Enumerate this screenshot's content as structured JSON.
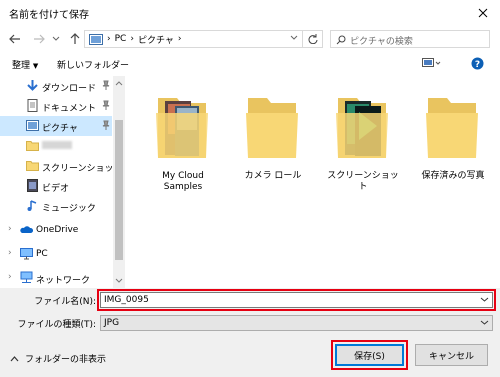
{
  "dialog": {
    "title": "名前を付けて保存"
  },
  "nav": {
    "breadcrumb": [
      "PC",
      "ピクチャ"
    ],
    "search_placeholder": "ピクチャの検索"
  },
  "toolbar": {
    "organize": "整理",
    "new_folder": "新しいフォルダー"
  },
  "sidebar": {
    "items": [
      {
        "label": "ダウンロード"
      },
      {
        "label": "ドキュメント"
      },
      {
        "label": "ピクチャ"
      },
      {
        "label": ""
      },
      {
        "label": "スクリーンショット"
      },
      {
        "label": "ビデオ"
      },
      {
        "label": "ミュージック"
      },
      {
        "label": "OneDrive"
      },
      {
        "label": "PC"
      },
      {
        "label": "ネットワーク"
      }
    ]
  },
  "folders": [
    {
      "label": "My Cloud Samples"
    },
    {
      "label": "カメラ ロール"
    },
    {
      "label": "スクリーンショット"
    },
    {
      "label": "保存済みの写真"
    }
  ],
  "form": {
    "filename_label": "ファイル名(N):",
    "filename_value": "IMG_0095",
    "filetype_label": "ファイルの種類(T):",
    "filetype_value": "JPG"
  },
  "footer": {
    "hide_folders": "フォルダーの非表示",
    "save": "保存(S)",
    "cancel": "キャンセル"
  },
  "colors": {
    "accent": "#0078d7",
    "highlight": "#e60012",
    "selection": "#cce8ff",
    "folder": "#f8d775"
  }
}
